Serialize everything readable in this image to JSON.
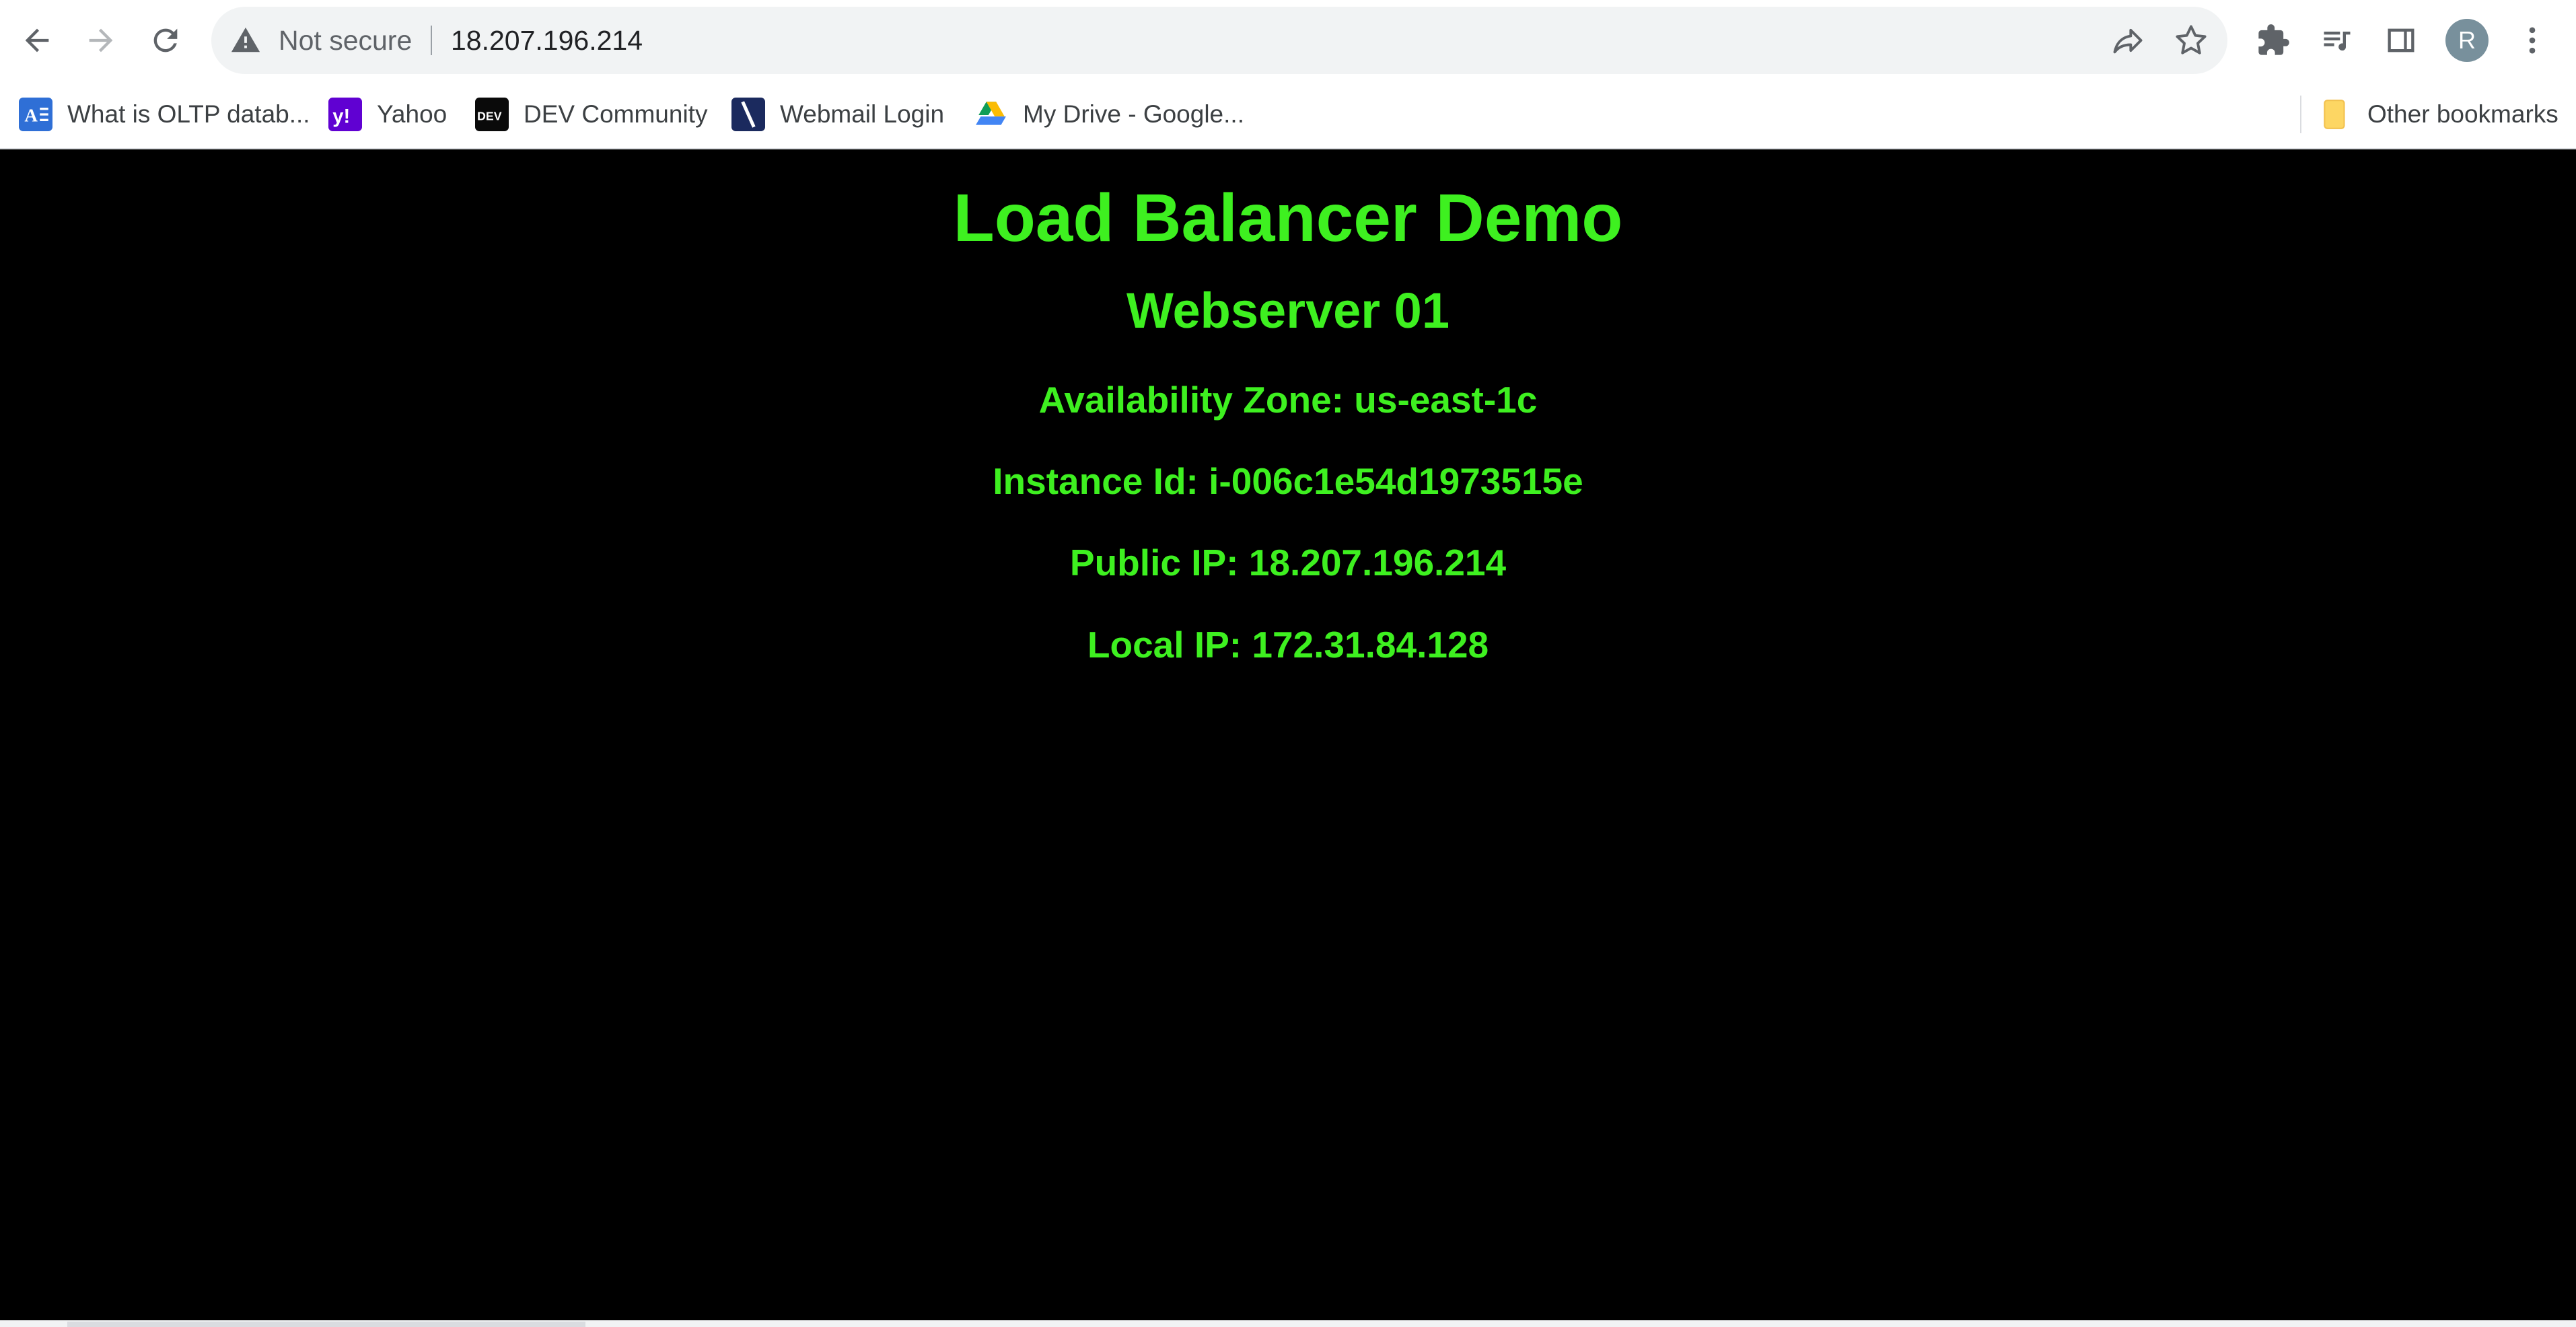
{
  "browser": {
    "address_bar": {
      "security_label": "Not secure",
      "url": "18.207.196.214"
    },
    "profile_initial": "R",
    "bookmarks": [
      {
        "label": "What is OLTP datab...",
        "icon": "oltp-favicon"
      },
      {
        "label": "Yahoo",
        "icon": "yahoo-favicon"
      },
      {
        "label": "DEV Community",
        "icon": "dev-favicon"
      },
      {
        "label": "Webmail Login",
        "icon": "webmail-favicon"
      },
      {
        "label": "My Drive - Google...",
        "icon": "google-drive-favicon"
      }
    ],
    "other_bookmarks_label": "Other bookmarks"
  },
  "page": {
    "title": "Load Balancer Demo",
    "server_name": "Webserver 01",
    "availability_zone": "Availability Zone: us-east-1c",
    "instance_id": "Instance Id: i-006c1e54d1973515e",
    "public_ip": "Public IP: 18.207.196.214",
    "local_ip": "Local IP: 172.31.84.128"
  },
  "colors": {
    "page_background": "#000000",
    "text_green": "#3ef020"
  }
}
